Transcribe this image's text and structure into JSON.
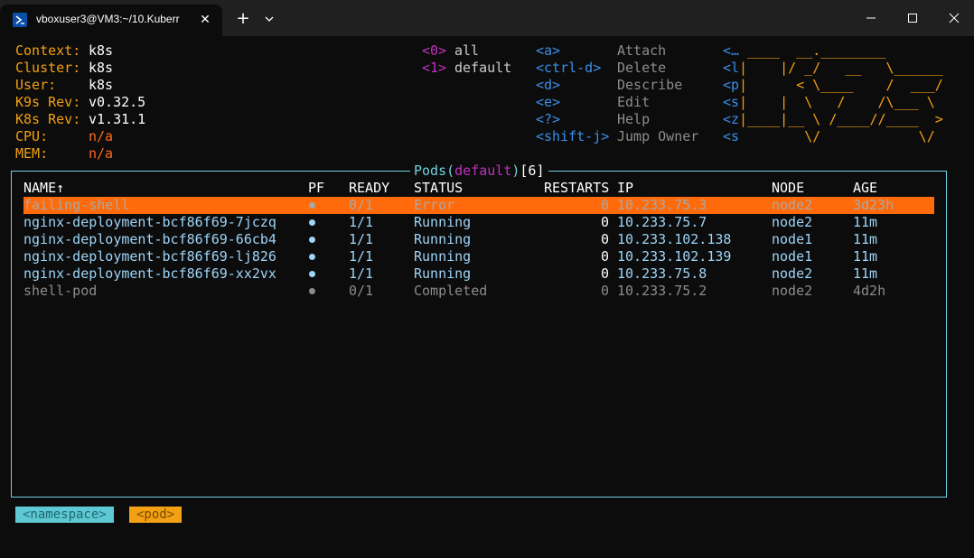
{
  "window": {
    "tab_title": "vboxuser3@VM3:~/10.Kuberr",
    "close_glyph": "✕",
    "new_tab_glyph": "+"
  },
  "info": {
    "labels": [
      "Context:",
      "Cluster:",
      "User:",
      "K9s Rev:",
      "K8s Rev:",
      "CPU:",
      "MEM:"
    ],
    "values": [
      "k8s",
      "k8s",
      "k8s",
      "v0.32.5",
      "v1.31.1",
      "n/a",
      "n/a"
    ]
  },
  "namespaces": [
    {
      "key": "<0>",
      "name": "all"
    },
    {
      "key": "<1>",
      "name": "default"
    }
  ],
  "shortcuts": [
    {
      "key": "<a>",
      "action": "Attach"
    },
    {
      "key": "<ctrl-d>",
      "action": "Delete"
    },
    {
      "key": "<d>",
      "action": "Describe"
    },
    {
      "key": "<e>",
      "action": "Edit"
    },
    {
      "key": "<?>",
      "action": "Help"
    },
    {
      "key": "<shift-j>",
      "action": "Jump Owner"
    }
  ],
  "logo": {
    "prefixes": [
      "<…",
      "<l",
      "<p",
      "<s",
      "<z",
      "<s"
    ],
    "lines": [
      " ____  __.________       ",
      "|    |/ _/   __   \\______",
      "|      < \\____    /  ___/",
      "|    |  \\   /    /\\___ \\ ",
      "|____|__ \\ /____//____  >",
      "        \\/            \\/ "
    ]
  },
  "pods": {
    "title_resource": "Pods",
    "title_open": "(",
    "title_namespace": "default",
    "title_close": ")",
    "title_count": "[6]",
    "columns": {
      "name": "NAME↑",
      "pf": "PF",
      "ready": "READY",
      "status": "STATUS",
      "restarts": "RESTARTS",
      "ip": "IP",
      "node": "NODE",
      "age": "AGE"
    },
    "rows": [
      {
        "name": "failing-shell",
        "ready": "0/1",
        "status": "Error",
        "restarts": "0",
        "ip": "10.233.75.3",
        "node": "node2",
        "age": "3d23h"
      },
      {
        "name": "nginx-deployment-bcf86f69-7jczq",
        "ready": "1/1",
        "status": "Running",
        "restarts": "0",
        "ip": "10.233.75.7",
        "node": "node2",
        "age": "11m"
      },
      {
        "name": "nginx-deployment-bcf86f69-66cb4",
        "ready": "1/1",
        "status": "Running",
        "restarts": "0",
        "ip": "10.233.102.138",
        "node": "node1",
        "age": "11m"
      },
      {
        "name": "nginx-deployment-bcf86f69-lj826",
        "ready": "1/1",
        "status": "Running",
        "restarts": "0",
        "ip": "10.233.102.139",
        "node": "node1",
        "age": "11m"
      },
      {
        "name": "nginx-deployment-bcf86f69-xx2vx",
        "ready": "1/1",
        "status": "Running",
        "restarts": "0",
        "ip": "10.233.75.8",
        "node": "node2",
        "age": "11m"
      },
      {
        "name": "shell-pod",
        "ready": "0/1",
        "status": "Completed",
        "restarts": "0",
        "ip": "10.233.75.2",
        "node": "node2",
        "age": "4d2h"
      }
    ]
  },
  "breadcrumbs": [
    "<namespace>",
    "<pod>"
  ],
  "colors": {
    "accent_orange": "#f3a012",
    "selection": "#ff6a0a",
    "border_cyan": "#6fd1e0",
    "running_blue": "#9dd4f7"
  }
}
